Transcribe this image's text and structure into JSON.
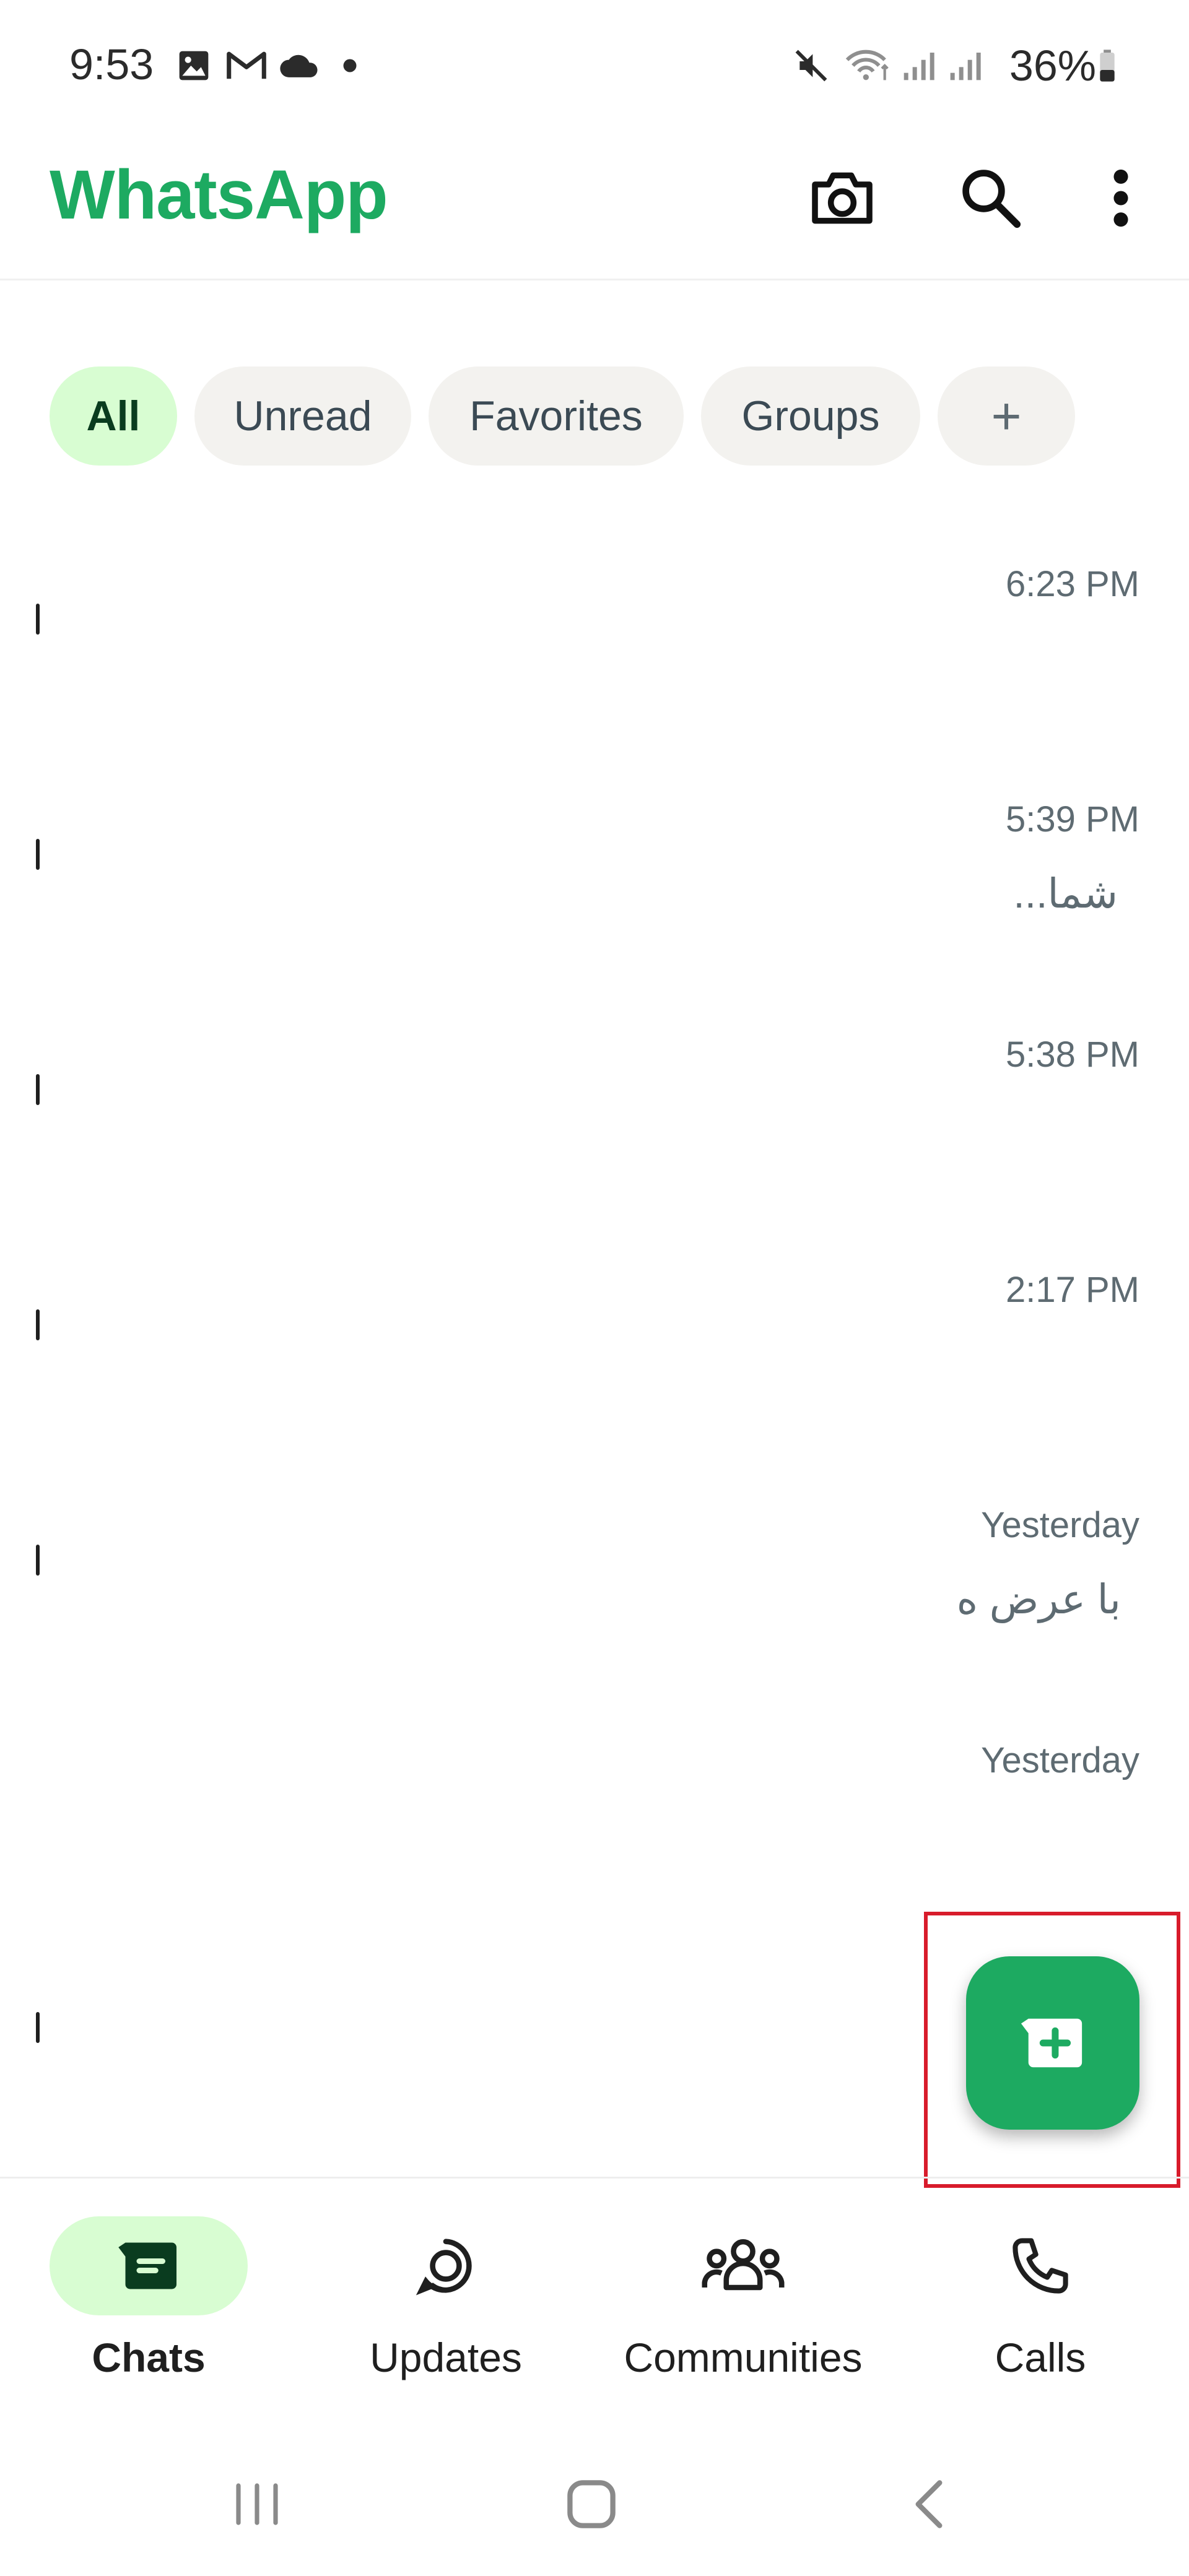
{
  "status_bar": {
    "time": "9:53",
    "battery": "36%",
    "icons_left": [
      "gallery-icon",
      "gmail-icon",
      "cloud-icon",
      "dot-icon"
    ],
    "icons_right": [
      "mute-icon",
      "wifi-icon",
      "signal-icon",
      "signal-icon",
      "battery-icon"
    ]
  },
  "header": {
    "title": "WhatsApp",
    "actions": [
      "camera-icon",
      "search-icon",
      "more-vert-icon"
    ]
  },
  "filters": {
    "chips": [
      {
        "label": "All",
        "active": true
      },
      {
        "label": "Unread",
        "active": false
      },
      {
        "label": "Favorites",
        "active": false
      },
      {
        "label": "Groups",
        "active": false
      },
      {
        "label": "+",
        "active": false
      }
    ]
  },
  "chats": [
    {
      "time": "6:23 PM",
      "preview": ""
    },
    {
      "time": "5:39 PM",
      "preview": "...شما"
    },
    {
      "time": "5:38 PM",
      "preview": ""
    },
    {
      "time": "2:17 PM",
      "preview": ""
    },
    {
      "time": "Yesterday",
      "preview": "با عرض ه"
    },
    {
      "time": "Yesterday",
      "preview": ""
    }
  ],
  "fab": {
    "icon": "new-chat-icon"
  },
  "bottom_nav": {
    "items": [
      {
        "label": "Chats",
        "icon": "chats-icon",
        "active": true
      },
      {
        "label": "Updates",
        "icon": "updates-icon",
        "active": false
      },
      {
        "label": "Communities",
        "icon": "communities-icon",
        "active": false
      },
      {
        "label": "Calls",
        "icon": "calls-icon",
        "active": false
      }
    ]
  },
  "system_nav": [
    "recents-icon",
    "home-icon",
    "back-icon"
  ],
  "colors": {
    "brand_green": "#1daa61",
    "chip_active_bg": "#d8fdd2",
    "highlight_red": "#d81b2b"
  }
}
